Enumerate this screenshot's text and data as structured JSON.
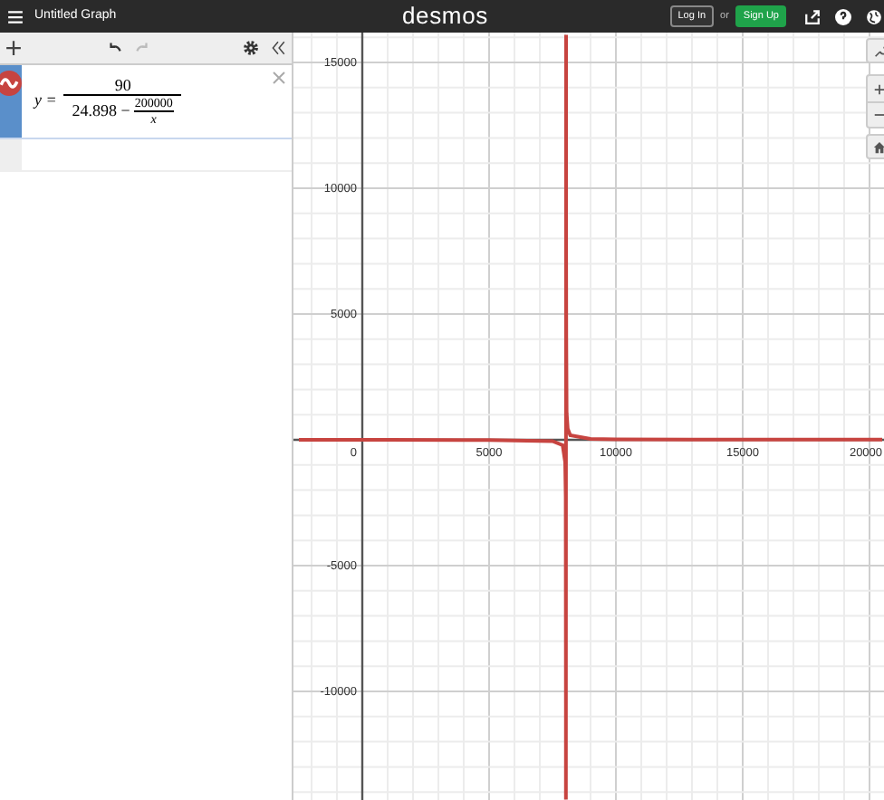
{
  "header": {
    "title": "Untitled Graph",
    "logo": "desmos",
    "login": "Log In",
    "or": "or",
    "signup": "Sign Up"
  },
  "expressions": [
    {
      "kind": "fraction",
      "lhs": "y =",
      "numerator": "90",
      "denominator_left": "24.898 −",
      "inner_numerator": "200000",
      "inner_denominator": "x"
    },
    {
      "kind": "empty"
    }
  ],
  "graph": {
    "chart_data": {
      "type": "line",
      "xlim": [
        -2714,
        20571
      ],
      "ylim": [
        -14317,
        16187
      ],
      "xticks": [
        {
          "value": 0,
          "label": "0"
        },
        {
          "value": 5000,
          "label": "5000"
        },
        {
          "value": 10000,
          "label": "10000"
        },
        {
          "value": 15000,
          "label": "15000"
        },
        {
          "value": 20000,
          "label": "20000"
        }
      ],
      "yticks": [
        {
          "value": 15000,
          "label": "15000"
        },
        {
          "value": 10000,
          "label": "10000"
        },
        {
          "value": 5000,
          "label": "5000"
        },
        {
          "value": -5000,
          "label": "-5000"
        },
        {
          "value": -10000,
          "label": "-10000"
        }
      ],
      "grid": true,
      "x": [
        -2500,
        1000,
        5000,
        7500,
        7900,
        8000,
        8020,
        8030,
        8031,
        8034,
        8036,
        8040,
        8060,
        8100,
        8200,
        9000,
        10000,
        15000,
        20500
      ],
      "series": [
        {
          "color": "#c74440",
          "values": [
            1,
            -1,
            -6,
            -51,
            -215,
            -882,
            -2267,
            -10465,
            -14300,
            16100,
            9000,
            4018,
            1070,
            435,
            177,
            34,
            18,
            8,
            6
          ]
        }
      ]
    }
  }
}
